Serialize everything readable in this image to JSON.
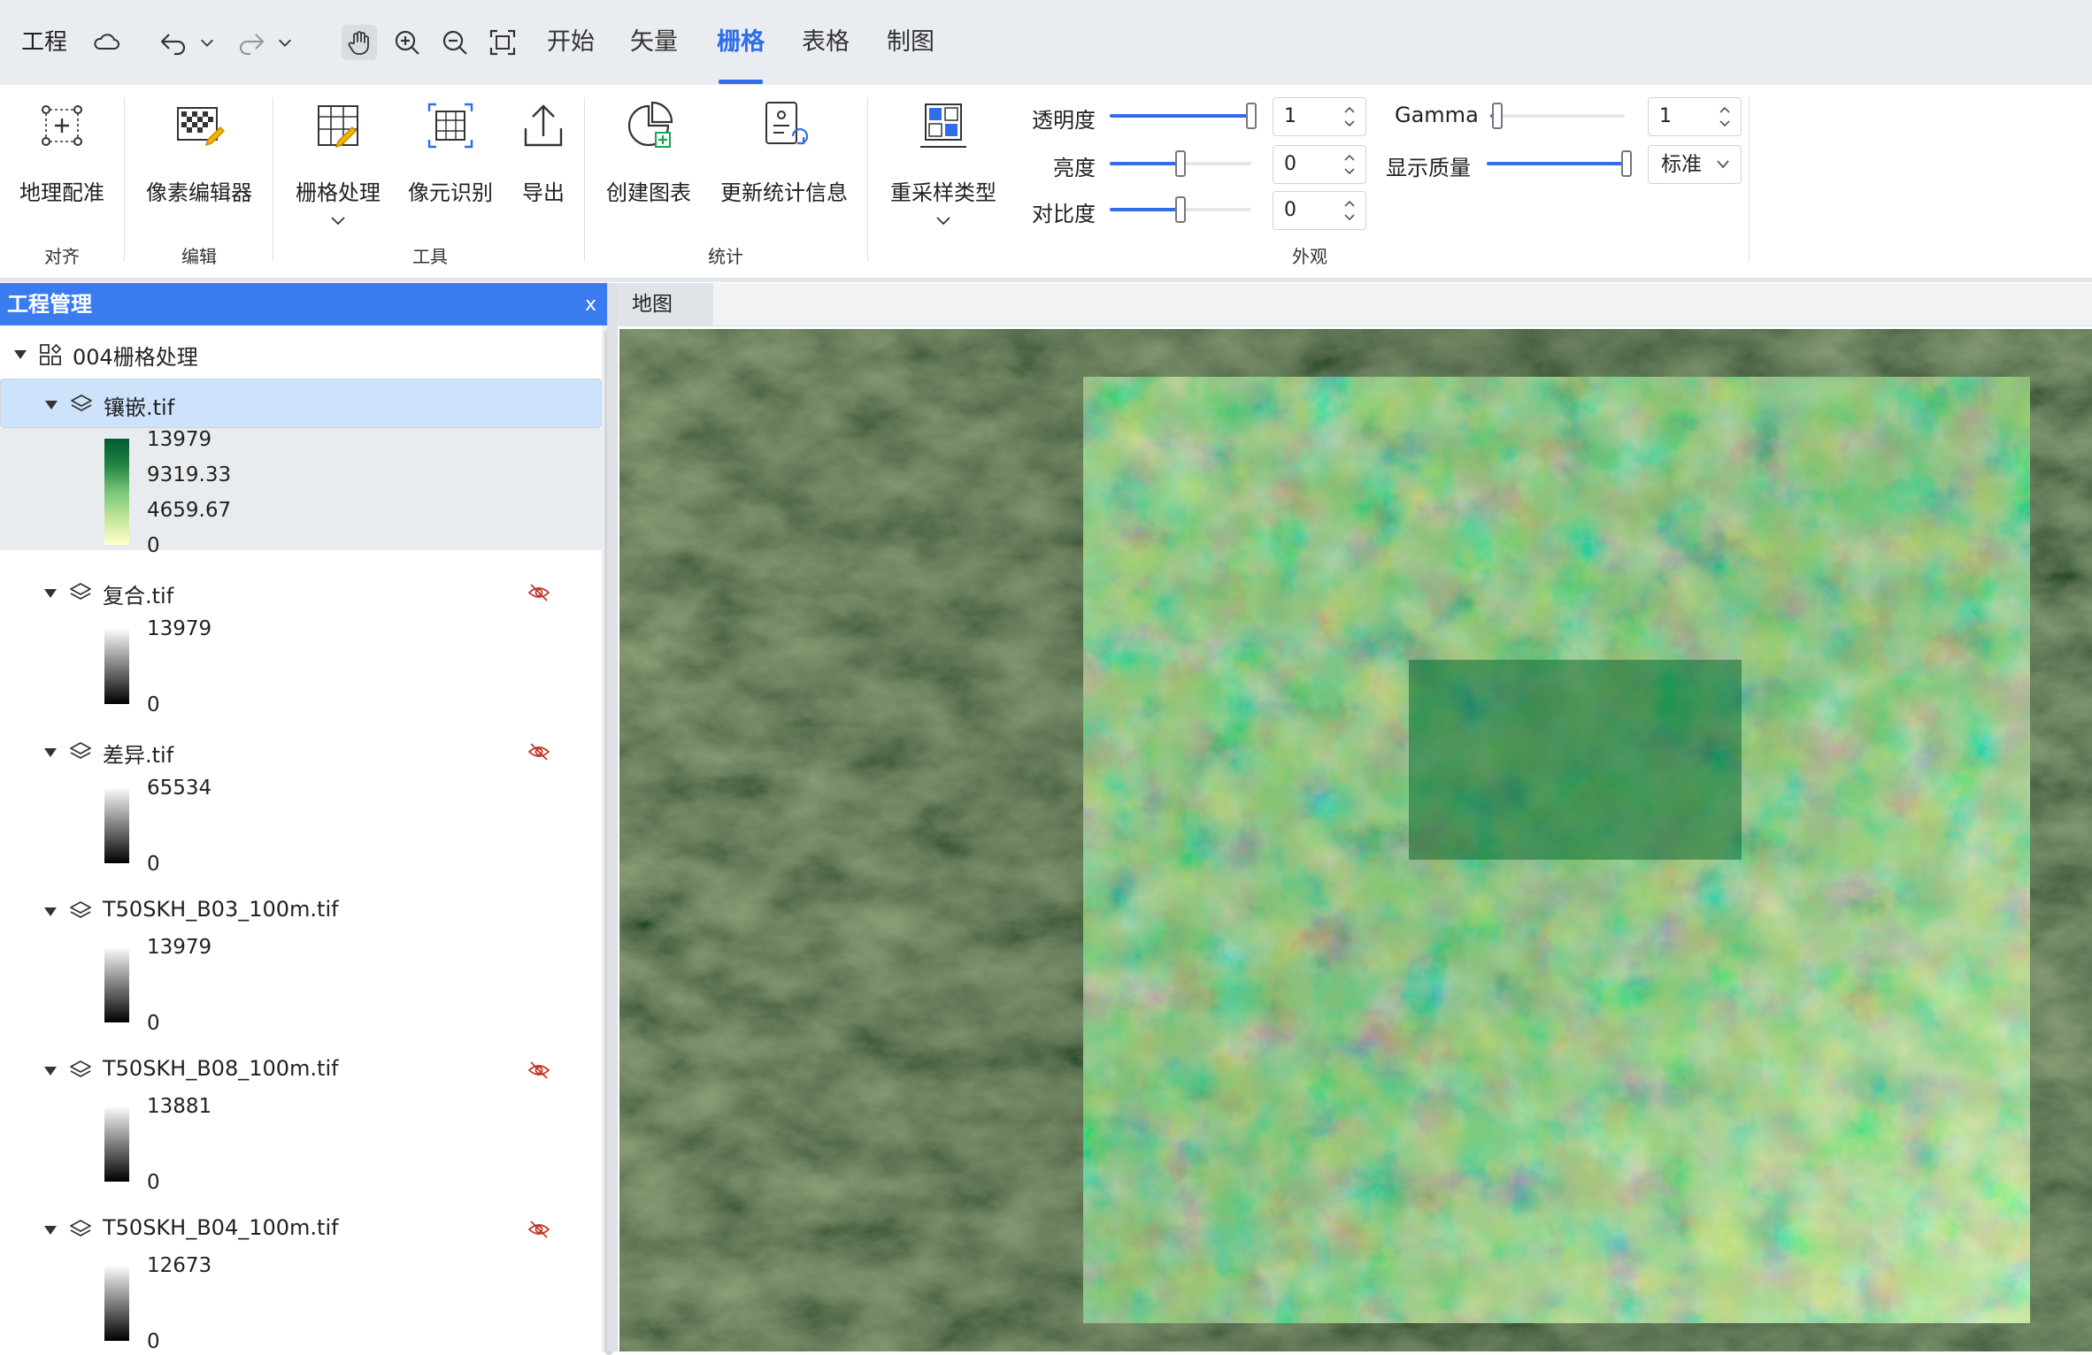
{
  "topbar": {
    "project_menu": "工程",
    "tabs": [
      {
        "label": "开始",
        "active": false
      },
      {
        "label": "矢量",
        "active": false
      },
      {
        "label": "栅格",
        "active": true
      },
      {
        "label": "表格",
        "active": false
      },
      {
        "label": "制图",
        "active": false
      }
    ],
    "icons": [
      "cloud-icon",
      "undo-icon",
      "chevron-down-icon",
      "redo-icon",
      "chevron-down-icon",
      "pan-hand-icon",
      "zoom-in-icon",
      "zoom-out-icon",
      "full-extent-icon"
    ]
  },
  "ribbon": {
    "align_group": {
      "label": "对齐",
      "buttons": [
        {
          "label": "地理配准",
          "icon": "georeference-icon"
        }
      ]
    },
    "edit_group": {
      "label": "编辑",
      "buttons": [
        {
          "label": "像素编辑器",
          "icon": "pixel-editor-icon"
        }
      ]
    },
    "tools_group": {
      "label": "工具",
      "buttons": [
        {
          "label": "栅格处理",
          "icon": "raster-processing-icon"
        },
        {
          "label": "像元识别",
          "icon": "pixel-identify-icon"
        },
        {
          "label": "导出",
          "icon": "export-icon"
        }
      ]
    },
    "stats_group": {
      "label": "统计",
      "buttons": [
        {
          "label": "创建图表",
          "icon": "create-chart-icon"
        },
        {
          "label": "更新统计信息",
          "icon": "update-stats-icon"
        }
      ]
    },
    "appearance_group": {
      "label": "外观",
      "resample_label": "重采样类型",
      "transparency_label": "透明度",
      "transparency_value": "1",
      "transparency_level": 1.0,
      "brightness_label": "亮度",
      "brightness_value": "0",
      "brightness_level": 0.5,
      "contrast_label": "对比度",
      "contrast_value": "0",
      "contrast_level": 0.5,
      "gamma_label": "Gamma",
      "gamma_value": "1",
      "gamma_level": 0.05,
      "quality_label": "显示质量",
      "quality_level": 1.0,
      "quality_value": "标准"
    },
    "accent_color": "#2f6ee8"
  },
  "panel": {
    "title": "工程管理",
    "close": "x",
    "project": "004栅格处理",
    "layers": [
      {
        "name": "镶嵌.tif",
        "ramp": "green",
        "visible": true,
        "selected": true,
        "labels": [
          "13979",
          "9319.33",
          "4659.67",
          "0"
        ]
      },
      {
        "name": "复合.tif",
        "ramp": "gray",
        "visible": false,
        "labels": [
          "13979",
          "0"
        ]
      },
      {
        "name": "差异.tif",
        "ramp": "gray",
        "visible": false,
        "labels": [
          "65534",
          "0"
        ]
      },
      {
        "name": "T50SKH_B03_100m.tif",
        "ramp": "gray",
        "visible": true,
        "labels": [
          "13979",
          "0"
        ]
      },
      {
        "name": "T50SKH_B08_100m.tif",
        "ramp": "gray",
        "visible": false,
        "labels": [
          "13881",
          "0"
        ]
      },
      {
        "name": "T50SKH_B04_100m.tif",
        "ramp": "gray",
        "visible": false,
        "labels": [
          "12673",
          "0"
        ]
      }
    ]
  },
  "map": {
    "tab_label": "地图",
    "ramp_colors": [
      "#ffffcc",
      "#c2e699",
      "#78c679",
      "#238443",
      "#005a32"
    ]
  }
}
